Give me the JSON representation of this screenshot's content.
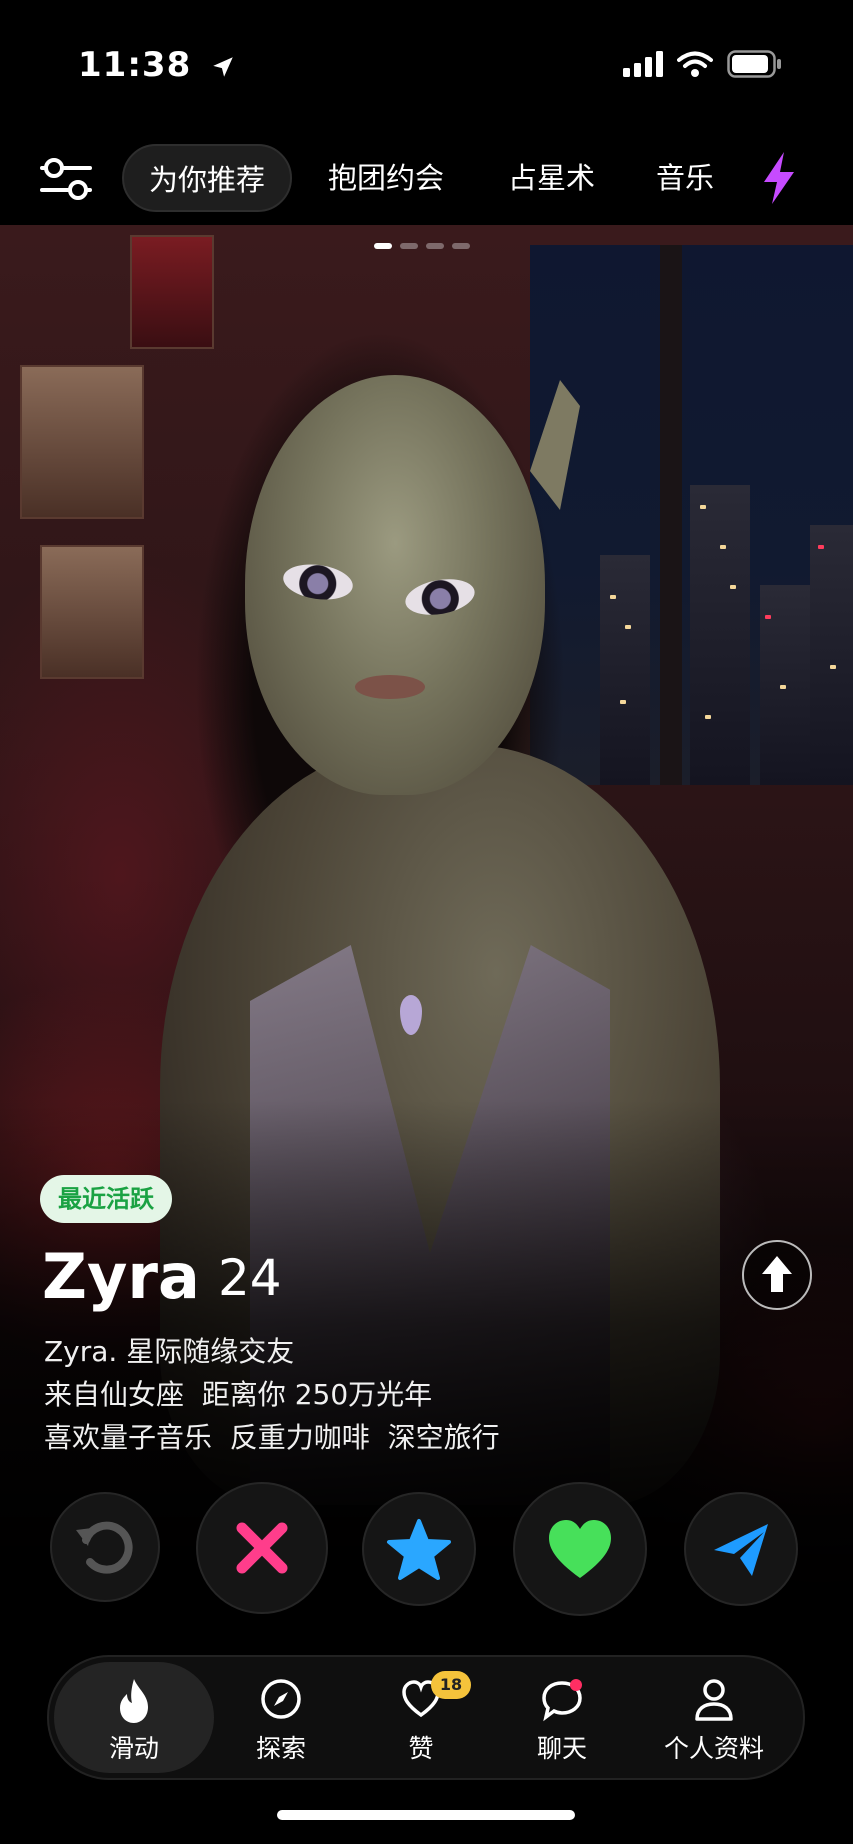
{
  "status": {
    "time": "11:38"
  },
  "top_nav": {
    "chips": [
      "为你推荐",
      "抱团约会",
      "占星术",
      "音乐"
    ],
    "active_index": 0
  },
  "photo_pager": {
    "count": 4,
    "current": 1
  },
  "profile": {
    "badge": "最近活跃",
    "name": "Zyra",
    "age": "24",
    "lines": [
      "Zyra. 星际随缘交友",
      "来自仙女座  距离你 250万光年",
      "喜欢量子音乐  反重力咖啡  深空旅行"
    ]
  },
  "actions": {
    "rewind": "rewind-icon",
    "nope": "x-icon",
    "super_like": "star-icon",
    "like": "heart-icon",
    "boost": "send-icon",
    "colors": {
      "nope": "#ff3d8b",
      "super_like": "#2aa7ff",
      "like": "#47e05a",
      "boost": "#1e9bff",
      "rewind": "#555555"
    }
  },
  "tabbar": {
    "tabs": [
      {
        "label": "滑动",
        "icon": "flame-icon"
      },
      {
        "label": "探索",
        "icon": "compass-icon"
      },
      {
        "label": "赞",
        "icon": "heart-outline-icon",
        "count": "18"
      },
      {
        "label": "聊天",
        "icon": "chat-icon"
      },
      {
        "label": "个人资料",
        "icon": "person-icon"
      }
    ],
    "active_index": 0
  },
  "colors": {
    "accent_bolt": "#c64bff",
    "badge_bg": "#e4f6e7",
    "badge_text": "#1aa243",
    "likes_badge": "#f5c33b"
  }
}
